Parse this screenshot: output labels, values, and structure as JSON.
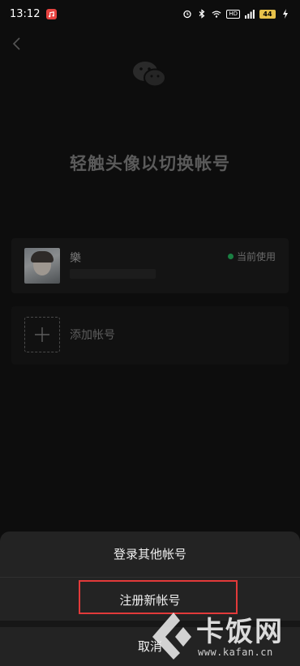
{
  "status_bar": {
    "time": "13:12",
    "hd_label": "HD",
    "battery": "44",
    "notification_icon": "app-notification-icon",
    "icons": [
      "alarm-icon",
      "bluetooth-icon",
      "wifi-icon",
      "signal-icon",
      "charging-icon"
    ]
  },
  "header": {
    "back_icon": "back-arrow-icon",
    "logo_icon": "wechat-logo-icon",
    "title": "轻触头像以切换帐号"
  },
  "accounts": [
    {
      "name": "樂",
      "status": "当前使用",
      "status_color": "#1a7f42"
    }
  ],
  "add_account": {
    "label": "添加帐号",
    "icon": "plus-icon"
  },
  "action_sheet": {
    "login_other": "登录其他帐号",
    "register_new": "注册新帐号",
    "cancel": "取消"
  },
  "highlight_color": "#e23a3a",
  "watermark": {
    "brand": "卡饭网",
    "url": "www.kafan.cn"
  }
}
